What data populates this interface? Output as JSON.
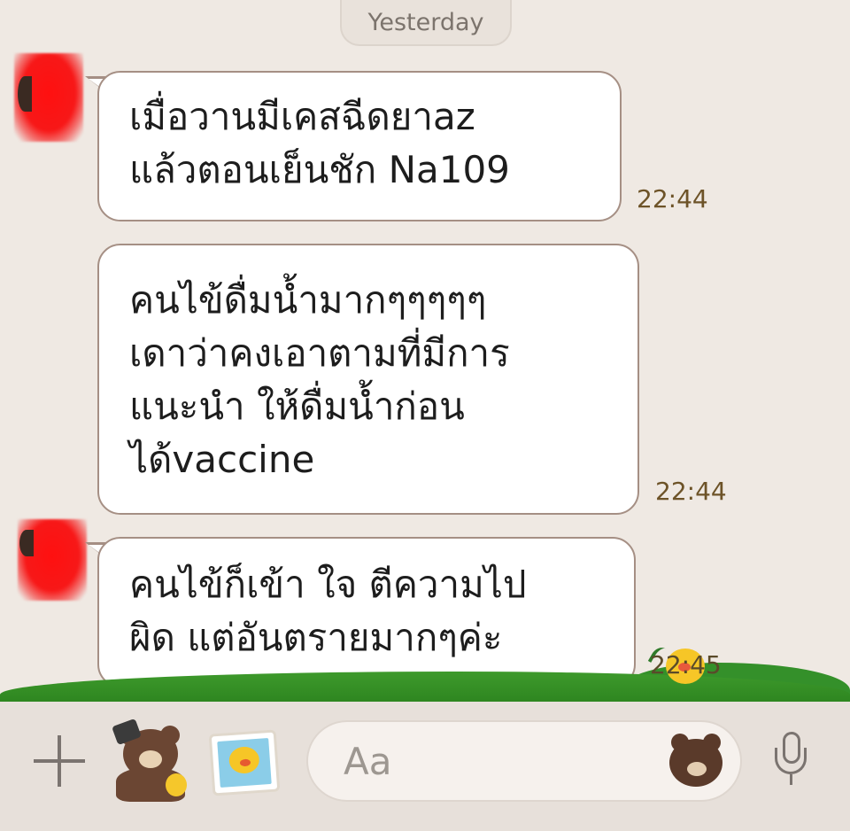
{
  "chat": {
    "date_separator": "Yesterday",
    "messages": [
      {
        "lines": [
          "เมื่อวานมีเคสฉีดยาaz",
          "แล้วตอนเย็นชัก Na109"
        ],
        "time": "22:44"
      },
      {
        "lines": [
          "คนไข้ดื่มน้ำมากๆๆๆๆๆ",
          "เดาว่าคงเอาตามที่มีการ",
          "แนะนำ ให้ดื่มน้ำก่อน",
          "ได้vaccine"
        ],
        "time": "22:44"
      },
      {
        "lines": [
          "คนไข้ก็เข้า ใจ ตีความไป",
          "ผิด แต่อันตรายมากๆค่ะ"
        ],
        "time": "22:45"
      }
    ]
  },
  "input_bar": {
    "placeholder": "Aa",
    "icons": [
      "plus-icon",
      "sticker-bear-icon",
      "photo-icon",
      "emoji-bear-icon",
      "microphone-icon"
    ]
  },
  "colors": {
    "background": "#efe9e3",
    "bubble_border": "#a58f84",
    "time_text": "#6d5328",
    "grass": "#3e9a2c"
  }
}
